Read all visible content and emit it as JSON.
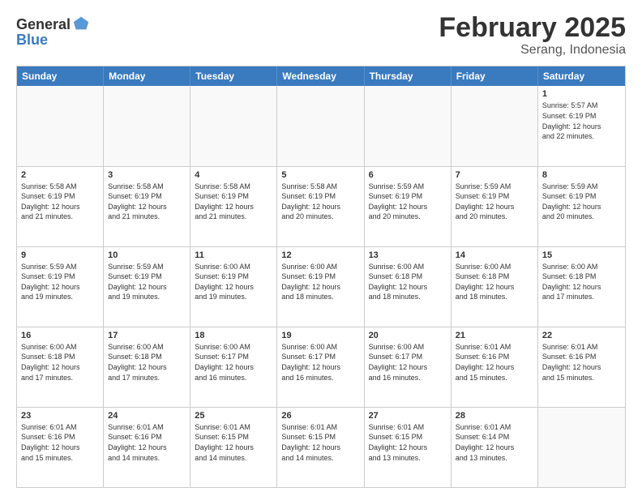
{
  "logo": {
    "general": "General",
    "blue": "Blue"
  },
  "title": {
    "month": "February 2025",
    "location": "Serang, Indonesia"
  },
  "calendar": {
    "headers": [
      "Sunday",
      "Monday",
      "Tuesday",
      "Wednesday",
      "Thursday",
      "Friday",
      "Saturday"
    ],
    "weeks": [
      [
        {
          "day": "",
          "info": ""
        },
        {
          "day": "",
          "info": ""
        },
        {
          "day": "",
          "info": ""
        },
        {
          "day": "",
          "info": ""
        },
        {
          "day": "",
          "info": ""
        },
        {
          "day": "",
          "info": ""
        },
        {
          "day": "1",
          "info": "Sunrise: 5:57 AM\nSunset: 6:19 PM\nDaylight: 12 hours\nand 22 minutes."
        }
      ],
      [
        {
          "day": "2",
          "info": "Sunrise: 5:58 AM\nSunset: 6:19 PM\nDaylight: 12 hours\nand 21 minutes."
        },
        {
          "day": "3",
          "info": "Sunrise: 5:58 AM\nSunset: 6:19 PM\nDaylight: 12 hours\nand 21 minutes."
        },
        {
          "day": "4",
          "info": "Sunrise: 5:58 AM\nSunset: 6:19 PM\nDaylight: 12 hours\nand 21 minutes."
        },
        {
          "day": "5",
          "info": "Sunrise: 5:58 AM\nSunset: 6:19 PM\nDaylight: 12 hours\nand 20 minutes."
        },
        {
          "day": "6",
          "info": "Sunrise: 5:59 AM\nSunset: 6:19 PM\nDaylight: 12 hours\nand 20 minutes."
        },
        {
          "day": "7",
          "info": "Sunrise: 5:59 AM\nSunset: 6:19 PM\nDaylight: 12 hours\nand 20 minutes."
        },
        {
          "day": "8",
          "info": "Sunrise: 5:59 AM\nSunset: 6:19 PM\nDaylight: 12 hours\nand 20 minutes."
        }
      ],
      [
        {
          "day": "9",
          "info": "Sunrise: 5:59 AM\nSunset: 6:19 PM\nDaylight: 12 hours\nand 19 minutes."
        },
        {
          "day": "10",
          "info": "Sunrise: 5:59 AM\nSunset: 6:19 PM\nDaylight: 12 hours\nand 19 minutes."
        },
        {
          "day": "11",
          "info": "Sunrise: 6:00 AM\nSunset: 6:19 PM\nDaylight: 12 hours\nand 19 minutes."
        },
        {
          "day": "12",
          "info": "Sunrise: 6:00 AM\nSunset: 6:19 PM\nDaylight: 12 hours\nand 18 minutes."
        },
        {
          "day": "13",
          "info": "Sunrise: 6:00 AM\nSunset: 6:18 PM\nDaylight: 12 hours\nand 18 minutes."
        },
        {
          "day": "14",
          "info": "Sunrise: 6:00 AM\nSunset: 6:18 PM\nDaylight: 12 hours\nand 18 minutes."
        },
        {
          "day": "15",
          "info": "Sunrise: 6:00 AM\nSunset: 6:18 PM\nDaylight: 12 hours\nand 17 minutes."
        }
      ],
      [
        {
          "day": "16",
          "info": "Sunrise: 6:00 AM\nSunset: 6:18 PM\nDaylight: 12 hours\nand 17 minutes."
        },
        {
          "day": "17",
          "info": "Sunrise: 6:00 AM\nSunset: 6:18 PM\nDaylight: 12 hours\nand 17 minutes."
        },
        {
          "day": "18",
          "info": "Sunrise: 6:00 AM\nSunset: 6:17 PM\nDaylight: 12 hours\nand 16 minutes."
        },
        {
          "day": "19",
          "info": "Sunrise: 6:00 AM\nSunset: 6:17 PM\nDaylight: 12 hours\nand 16 minutes."
        },
        {
          "day": "20",
          "info": "Sunrise: 6:00 AM\nSunset: 6:17 PM\nDaylight: 12 hours\nand 16 minutes."
        },
        {
          "day": "21",
          "info": "Sunrise: 6:01 AM\nSunset: 6:16 PM\nDaylight: 12 hours\nand 15 minutes."
        },
        {
          "day": "22",
          "info": "Sunrise: 6:01 AM\nSunset: 6:16 PM\nDaylight: 12 hours\nand 15 minutes."
        }
      ],
      [
        {
          "day": "23",
          "info": "Sunrise: 6:01 AM\nSunset: 6:16 PM\nDaylight: 12 hours\nand 15 minutes."
        },
        {
          "day": "24",
          "info": "Sunrise: 6:01 AM\nSunset: 6:16 PM\nDaylight: 12 hours\nand 14 minutes."
        },
        {
          "day": "25",
          "info": "Sunrise: 6:01 AM\nSunset: 6:15 PM\nDaylight: 12 hours\nand 14 minutes."
        },
        {
          "day": "26",
          "info": "Sunrise: 6:01 AM\nSunset: 6:15 PM\nDaylight: 12 hours\nand 14 minutes."
        },
        {
          "day": "27",
          "info": "Sunrise: 6:01 AM\nSunset: 6:15 PM\nDaylight: 12 hours\nand 13 minutes."
        },
        {
          "day": "28",
          "info": "Sunrise: 6:01 AM\nSunset: 6:14 PM\nDaylight: 12 hours\nand 13 minutes."
        },
        {
          "day": "",
          "info": ""
        }
      ]
    ]
  }
}
